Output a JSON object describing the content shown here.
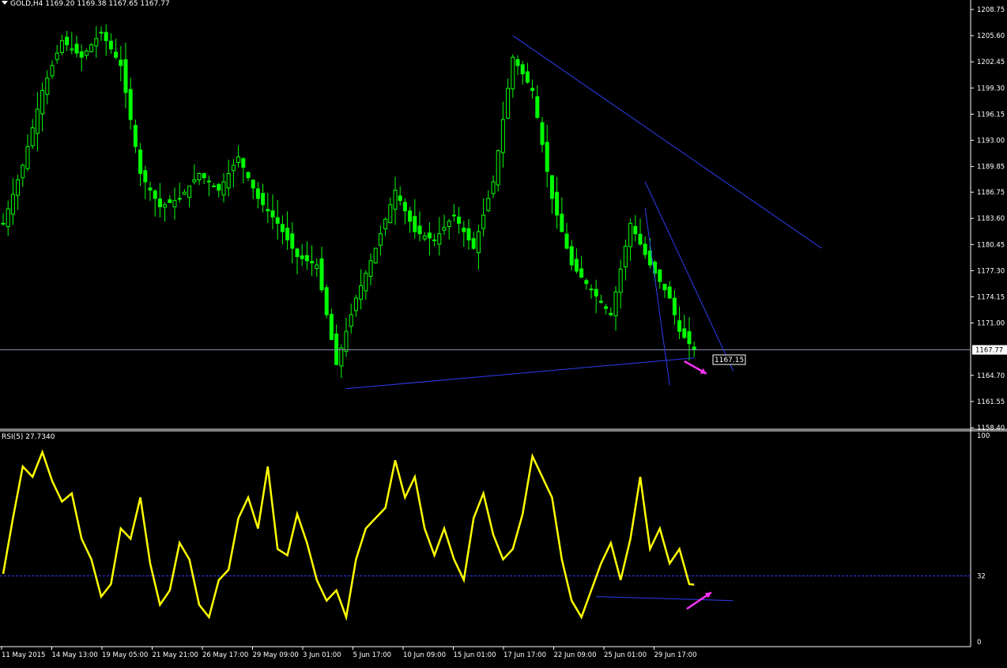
{
  "window": {
    "symbol_label": "GOLD,H4",
    "ohlc_text": "1169.20 1169.38 1167.65 1167.77",
    "rsi_label": "RSI(5) 27.7340"
  },
  "colors": {
    "background": "#000000",
    "candles": "#00ff00",
    "trendlines": "#2e3df0",
    "rsi_line": "#ffff00",
    "arrows": "#ff33ff",
    "axis": "#ffffff"
  },
  "chart_data": [
    {
      "type": "line",
      "title": "",
      "legend_text": "GOLD,H4",
      "y_ticks": [
        1208.75,
        1205.6,
        1202.45,
        1199.3,
        1196.15,
        1193.0,
        1189.85,
        1186.75,
        1183.6,
        1180.45,
        1177.3,
        1174.15,
        1171.0,
        1167.77,
        1164.7,
        1161.55,
        1158.4
      ],
      "ylim": [
        1158.4,
        1208.75
      ],
      "x_tick_labels": [
        "11 May 2015",
        "14 May 13:00",
        "19 May 05:00",
        "21 May 21:00",
        "26 May 17:00",
        "29 May 09:00",
        "3 Jun 01:00",
        "5 Jun 17:00",
        "10 Jun 09:00",
        "15 Jun 01:00",
        "17 Jun 17:00",
        "22 Jun 09:00",
        "25 Jun 01:00",
        "29 Jun 17:00"
      ],
      "series": [
        {
          "x": [
            0,
            4,
            8,
            12,
            16,
            20,
            24,
            28,
            32,
            36,
            40,
            44,
            48,
            52,
            56,
            60,
            64,
            68,
            72,
            76,
            80,
            84,
            88,
            92,
            96,
            100,
            104,
            108,
            112,
            116,
            120,
            124,
            128,
            132,
            136,
            138,
            141
          ],
          "values": [
            1183,
            1190,
            1199,
            1205,
            1203,
            1206,
            1202,
            1189,
            1185,
            1186,
            1189,
            1187,
            1191,
            1186,
            1183,
            1179,
            1178,
            1166,
            1174,
            1180,
            1187,
            1182,
            1181,
            1184,
            1180,
            1188,
            1203,
            1199,
            1186,
            1178,
            1175,
            1172,
            1183,
            1178,
            1174,
            1170,
            1167.77
          ]
        }
      ],
      "current_price": 1167.77,
      "annotations": [
        "1167.15"
      ]
    },
    {
      "type": "line",
      "legend_text": "RSI(5) 27.7340",
      "ylim": [
        0,
        100
      ],
      "y_ticks": [
        100,
        32,
        0
      ],
      "series": [
        {
          "x": [
            0,
            2,
            4,
            6,
            8,
            10,
            12,
            14,
            16,
            18,
            20,
            22,
            24,
            26,
            28,
            30,
            32,
            34,
            36,
            38,
            40,
            42,
            44,
            46,
            48,
            50,
            52,
            54,
            56,
            58,
            60,
            62,
            64,
            66,
            68,
            70,
            72,
            74,
            76,
            78,
            80,
            82,
            84,
            86,
            88,
            90,
            92,
            94,
            96,
            98,
            100,
            102,
            104,
            106,
            108,
            110,
            112,
            114,
            116,
            118,
            120,
            122,
            124,
            126,
            128,
            130,
            132,
            134,
            136,
            138,
            140,
            141
          ],
          "values": [
            33,
            60,
            85,
            80,
            92,
            78,
            68,
            72,
            50,
            40,
            22,
            28,
            55,
            50,
            70,
            38,
            18,
            25,
            48,
            40,
            18,
            12,
            30,
            35,
            60,
            70,
            55,
            85,
            45,
            42,
            62,
            48,
            30,
            20,
            25,
            12,
            40,
            55,
            60,
            65,
            88,
            70,
            80,
            55,
            42,
            55,
            40,
            30,
            60,
            72,
            52,
            40,
            45,
            62,
            90,
            80,
            70,
            40,
            20,
            12,
            25,
            38,
            48,
            30,
            50,
            80,
            45,
            55,
            38,
            45,
            28,
            27.73
          ]
        }
      ],
      "level_line": 32
    }
  ]
}
